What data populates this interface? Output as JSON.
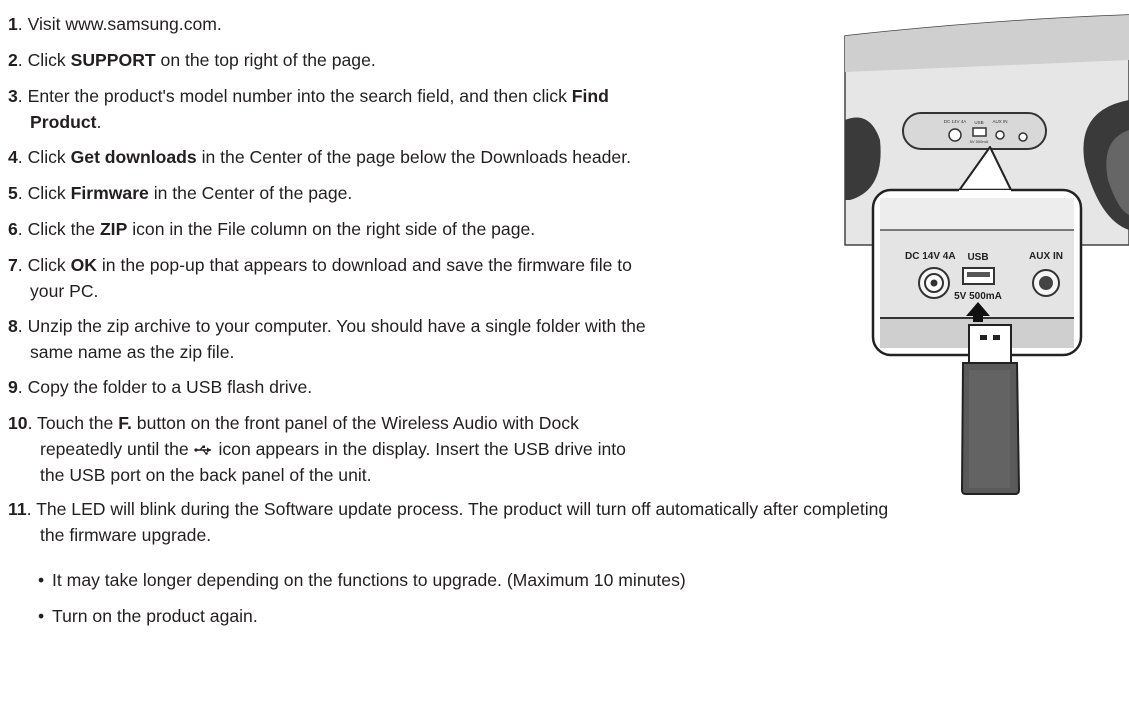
{
  "steps": [
    {
      "num": "1",
      "lines": [
        [
          {
            "t": "Visit www.samsung.com."
          }
        ]
      ]
    },
    {
      "num": "2",
      "lines": [
        [
          {
            "t": "Click "
          },
          {
            "t": "SUPPORT",
            "b": true
          },
          {
            "t": " on the top right of the page."
          }
        ]
      ]
    },
    {
      "num": "3",
      "lines": [
        [
          {
            "t": "Enter the product's model number into the search field, and then click "
          },
          {
            "t": "Find",
            "b": true
          }
        ],
        [
          {
            "t": "Product",
            "b": true
          },
          {
            "t": "."
          }
        ]
      ]
    },
    {
      "num": "4",
      "lines": [
        [
          {
            "t": "Click "
          },
          {
            "t": "Get downloads",
            "b": true
          },
          {
            "t": " in the Center of the page below the Downloads header."
          }
        ]
      ]
    },
    {
      "num": "5",
      "lines": [
        [
          {
            "t": "Click "
          },
          {
            "t": "Firmware",
            "b": true
          },
          {
            "t": " in the Center of the page."
          }
        ]
      ]
    },
    {
      "num": "6",
      "lines": [
        [
          {
            "t": "Click the "
          },
          {
            "t": "ZIP",
            "b": true
          },
          {
            "t": " icon in the File column on the right side of the page."
          }
        ]
      ]
    },
    {
      "num": "7",
      "lines": [
        [
          {
            "t": "Click "
          },
          {
            "t": "OK",
            "b": true
          },
          {
            "t": " in the pop-up that appears to download and save the firmware file to"
          }
        ],
        [
          {
            "t": "your PC."
          }
        ]
      ]
    },
    {
      "num": "8",
      "lines": [
        [
          {
            "t": "Unzip the zip archive to your computer. You should have a single folder with the"
          }
        ],
        [
          {
            "t": "same name as the zip file."
          }
        ]
      ]
    },
    {
      "num": "9",
      "lines": [
        [
          {
            "t": "Copy the folder to a USB flash drive."
          }
        ]
      ]
    },
    {
      "num": "10",
      "lines": [
        [
          {
            "t": "Touch the "
          },
          {
            "t": "F.",
            "b": true
          },
          {
            "t": " button on the front panel of the Wireless Audio with Dock"
          }
        ],
        [
          {
            "t": "repeatedly until the "
          },
          {
            "icon": "usb-icon"
          },
          {
            "t": " icon appears in the display.  Insert the USB drive into"
          }
        ],
        [
          {
            "t": "the USB port on the back panel of the unit."
          }
        ]
      ]
    },
    {
      "num": "11",
      "lines": [
        [
          {
            "t": "The LED will blink during the Software update process. The product will turn off automatically after completing"
          }
        ],
        [
          {
            "t": "the firmware upgrade."
          }
        ]
      ]
    }
  ],
  "bullets": [
    "It may take longer depending on the functions to upgrade. (Maximum 10 minutes)",
    "Turn on the product again."
  ],
  "illustration": {
    "port_labels": {
      "dc": "DC 14V 4A",
      "usb": "USB",
      "usb_rating": "5V 500mA",
      "aux": "AUX IN"
    },
    "small_labels": {
      "dc": "DC 14V 4A",
      "usb": "USB",
      "usb_rating": "5V 500mA",
      "aux": "AUX IN"
    }
  }
}
